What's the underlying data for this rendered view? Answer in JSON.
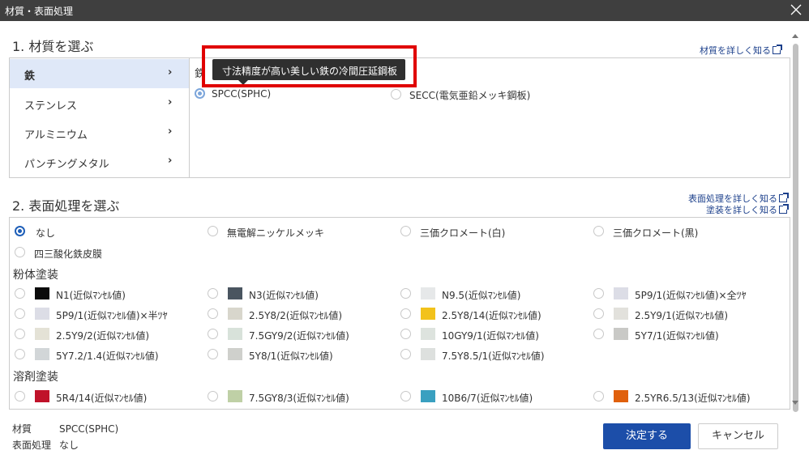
{
  "window": {
    "title": "材質・表面処理"
  },
  "material": {
    "heading": "1. 材質を選ぶ",
    "detail_link": "材質を詳しく知る",
    "categories": [
      {
        "label": "鉄",
        "active": true
      },
      {
        "label": "ステンレス",
        "active": false
      },
      {
        "label": "アルミニウム",
        "active": false
      },
      {
        "label": "パンチングメタル",
        "active": false
      }
    ],
    "chevron": "›",
    "group_label": "鉄",
    "tooltip": "寸法精度が高い美しい鉄の冷間圧延鋼板",
    "options": [
      {
        "label": "SPCC(SPHC)",
        "selected": true
      },
      {
        "label": "SECC(電気亜鉛メッキ鋼板)",
        "selected": false
      }
    ]
  },
  "surface": {
    "heading": "2. 表面処理を選ぶ",
    "detail_link": "表面処理を詳しく知る",
    "paint_link": "塗装を詳しく知る",
    "basic_options": [
      {
        "label": "なし",
        "selected": true
      },
      {
        "label": "無電解ニッケルメッキ",
        "selected": false
      },
      {
        "label": "三価クロメート(白)",
        "selected": false
      },
      {
        "label": "三価クロメート(黒)",
        "selected": false
      },
      {
        "label": "四三酸化鉄皮膜",
        "selected": false
      }
    ],
    "powder_heading": "粉体塗装",
    "powder_options": [
      {
        "label": "N1(近似ﾏﾝｾﾙ値)",
        "color": "#0b0b0b"
      },
      {
        "label": "N3(近似ﾏﾝｾﾙ値)",
        "color": "#4a5560"
      },
      {
        "label": "N9.5(近似ﾏﾝｾﾙ値)",
        "color": "#e6e8e9"
      },
      {
        "label": "5P9/1(近似ﾏﾝｾﾙ値)×全ﾂﾔ",
        "color": "#dcdde6"
      },
      {
        "label": "5P9/1(近似ﾏﾝｾﾙ値)×半ﾂﾔ",
        "color": "#dcdde6"
      },
      {
        "label": "2.5Y8/2(近似ﾏﾝｾﾙ値)",
        "color": "#d8d6cc"
      },
      {
        "label": "2.5Y8/14(近似ﾏﾝｾﾙ値)",
        "color": "#f2c21b"
      },
      {
        "label": "2.5Y9/1(近似ﾏﾝｾﾙ値)",
        "color": "#e2e1dc"
      },
      {
        "label": "2.5Y9/2(近似ﾏﾝｾﾙ値)",
        "color": "#e4e2d6"
      },
      {
        "label": "7.5GY9/2(近似ﾏﾝｾﾙ値)",
        "color": "#d8e2da"
      },
      {
        "label": "10GY9/1(近似ﾏﾝｾﾙ値)",
        "color": "#dde3de"
      },
      {
        "label": "5Y7/1(近似ﾏﾝｾﾙ値)",
        "color": "#c9c9c6"
      },
      {
        "label": "5Y7.2/1.4(近似ﾏﾝｾﾙ値)",
        "color": "#d2d6d8"
      },
      {
        "label": "5Y8/1(近似ﾏﾝｾﾙ値)",
        "color": "#cfd0cc"
      },
      {
        "label": "7.5Y8.5/1(近似ﾏﾝｾﾙ値)",
        "color": "#dde0de"
      }
    ],
    "solvent_heading": "溶剤塗装",
    "solvent_options": [
      {
        "label": "5R4/14(近似ﾏﾝｾﾙ値)",
        "color": "#c0122a"
      },
      {
        "label": "7.5GY8/3(近似ﾏﾝｾﾙ値)",
        "color": "#bfd0a6"
      },
      {
        "label": "10B6/7(近似ﾏﾝｾﾙ値)",
        "color": "#3aa0c0"
      },
      {
        "label": "2.5YR6.5/13(近似ﾏﾝｾﾙ値)",
        "color": "#e0600c"
      }
    ]
  },
  "summary": {
    "material_label": "材質",
    "material_value": "SPCC(SPHC)",
    "surface_label": "表面処理",
    "surface_value": "なし"
  },
  "buttons": {
    "confirm": "決定する",
    "cancel": "キャンセル"
  },
  "colors": {
    "primary": "#1c4ea9",
    "titlebar": "#3f3f3f",
    "link": "#1b3f8b",
    "highlight": "#e00000"
  }
}
